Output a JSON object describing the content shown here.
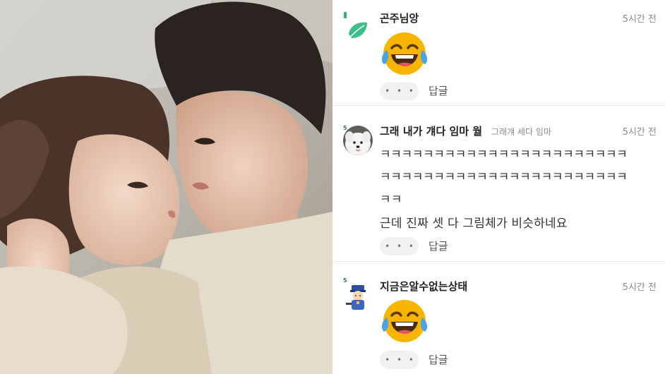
{
  "photo": {
    "description_icon": "drama-still-image"
  },
  "comments": [
    {
      "nickname": "곤주님앙",
      "sub_nickname": "",
      "time": "5시간 전",
      "avatar_icon": "leaf-icon",
      "content_type": "emoji",
      "emoji_icon": "laughing-crying-emoji-icon",
      "text_lines": [],
      "more_label": "• • •",
      "reply_label": "답글"
    },
    {
      "nickname": "그래 내가 걔다 임마 월",
      "sub_nickname": "그래걔 세다 임마",
      "time": "5시간 전",
      "level_badge": "5",
      "avatar_icon": "white-dog-avatar",
      "content_type": "text",
      "text_lines": [
        "ㅋㅋㅋㅋㅋㅋㅋㅋㅋㅋㅋㅋㅋㅋㅋㅋㅋㅋㅋㅋㅋㅋㅋ",
        "ㅋㅋㅋㅋㅋㅋㅋㅋㅋㅋㅋㅋㅋㅋㅋㅋㅋㅋㅋㅋㅋㅋㅋ",
        "ㅋㅋ",
        "근데 진짜 셋 다 그림체가 비슷하네요"
      ],
      "more_label": "• • •",
      "reply_label": "답글"
    },
    {
      "nickname": "지금은알수없는상태",
      "sub_nickname": "",
      "time": "5시간 전",
      "level_badge": "5",
      "avatar_icon": "police-character-avatar",
      "content_type": "emoji",
      "emoji_icon": "laughing-crying-emoji-icon",
      "text_lines": [],
      "more_label": "• • •",
      "reply_label": "답글"
    }
  ],
  "colors": {
    "divider": "#e6e6e6",
    "timestamp": "#8a8a8a",
    "level_green": "#2fb36d",
    "emoji_yellow": "#f7b500",
    "tear_blue": "#4aa3e8"
  }
}
